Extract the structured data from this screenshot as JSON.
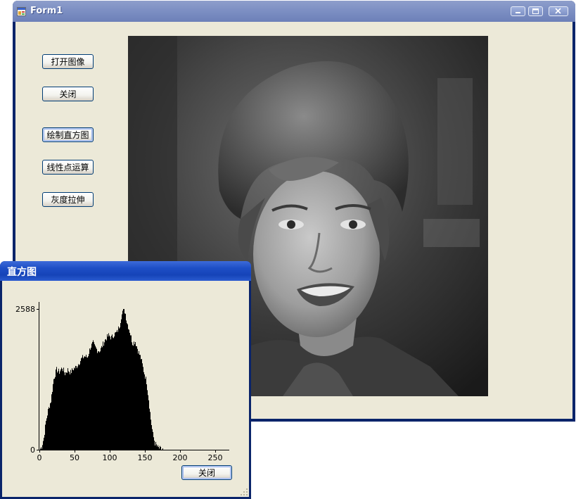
{
  "main_window": {
    "title": "Form1",
    "buttons": {
      "open_image": "打开图像",
      "close": "关闭",
      "draw_histogram": "绘制直方图",
      "linear_point_op": "线性点运算",
      "gray_stretch": "灰度拉伸"
    },
    "title_controls": [
      "minimize-icon",
      "maximize-icon",
      "close-icon"
    ]
  },
  "histogram_dialog": {
    "title": "直方图",
    "close_button": "关闭",
    "chart_data": {
      "type": "bar",
      "title": "",
      "xlabel": "",
      "ylabel": "",
      "xlim": [
        0,
        270
      ],
      "ylim": [
        0,
        2588
      ],
      "x_ticks": [
        "0",
        "50",
        "100",
        "150",
        "200",
        "250"
      ],
      "y_tick_labels": [
        "2588",
        "0"
      ],
      "color": "#000000",
      "profile": [
        [
          0,
          0
        ],
        [
          3,
          60
        ],
        [
          6,
          220
        ],
        [
          9,
          520
        ],
        [
          12,
          720
        ],
        [
          16,
          900
        ],
        [
          20,
          1300
        ],
        [
          24,
          1470
        ],
        [
          28,
          1430
        ],
        [
          32,
          1510
        ],
        [
          36,
          1400
        ],
        [
          40,
          1470
        ],
        [
          44,
          1420
        ],
        [
          48,
          1490
        ],
        [
          52,
          1520
        ],
        [
          56,
          1600
        ],
        [
          60,
          1680
        ],
        [
          64,
          1720
        ],
        [
          68,
          1700
        ],
        [
          72,
          1880
        ],
        [
          76,
          1960
        ],
        [
          78,
          1900
        ],
        [
          82,
          1830
        ],
        [
          86,
          1820
        ],
        [
          90,
          1940
        ],
        [
          94,
          2040
        ],
        [
          98,
          2100
        ],
        [
          102,
          2060
        ],
        [
          106,
          2120
        ],
        [
          110,
          2160
        ],
        [
          114,
          2300
        ],
        [
          116,
          2450
        ],
        [
          118,
          2520
        ],
        [
          120,
          2588
        ],
        [
          122,
          2500
        ],
        [
          124,
          2350
        ],
        [
          128,
          2180
        ],
        [
          132,
          1960
        ],
        [
          136,
          1990
        ],
        [
          140,
          1820
        ],
        [
          144,
          1680
        ],
        [
          148,
          1450
        ],
        [
          152,
          1250
        ],
        [
          155,
          930
        ],
        [
          158,
          560
        ],
        [
          161,
          280
        ],
        [
          164,
          120
        ],
        [
          168,
          40
        ],
        [
          172,
          10
        ],
        [
          176,
          0
        ],
        [
          270,
          0
        ]
      ]
    }
  },
  "colors": {
    "form_bg": "#ECE9D8",
    "inactive_title": "#7f91c4",
    "active_title": "#1e4fc6",
    "frame_dark": "#0A246A"
  }
}
